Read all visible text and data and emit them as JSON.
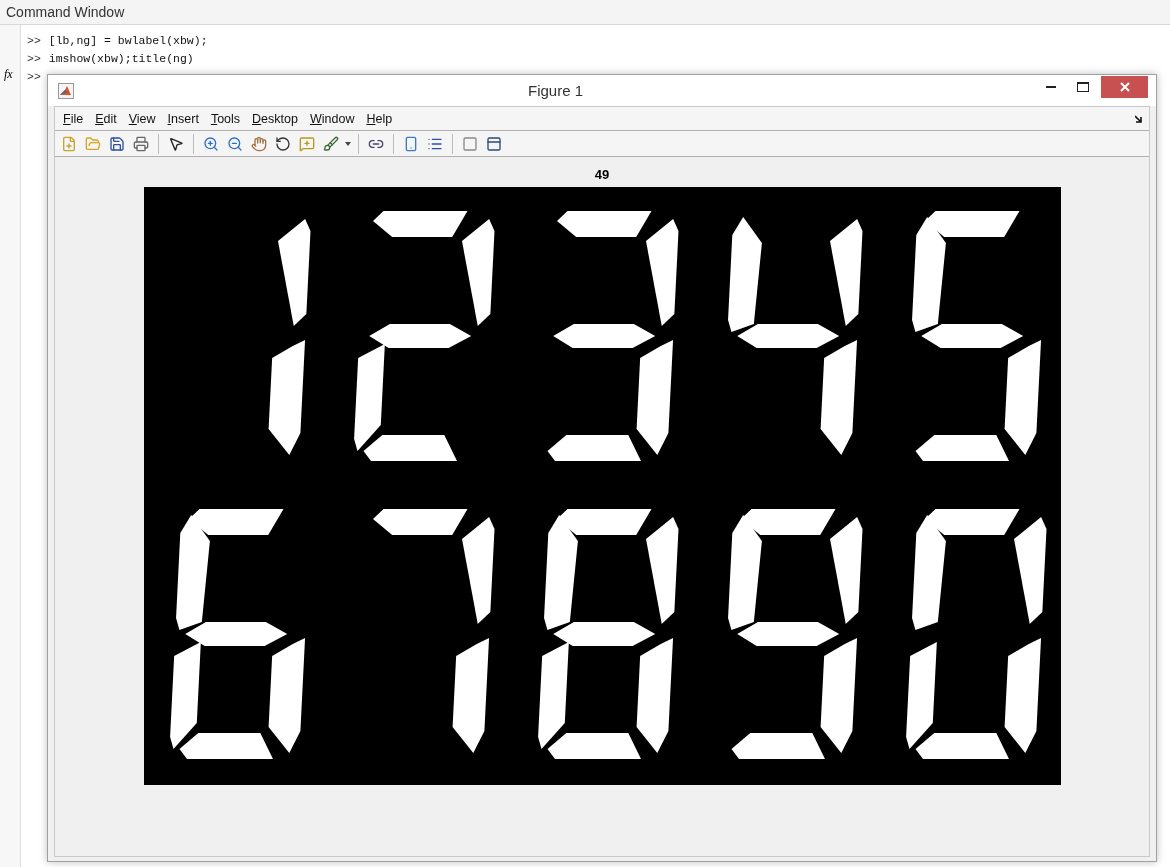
{
  "command_window": {
    "title": "Command Window",
    "lines": [
      {
        "prompt": ">>",
        "code": "[lb,ng] = bwlabel(xbw);"
      },
      {
        "prompt": ">>",
        "code": "imshow(xbw);title(ng)"
      },
      {
        "prompt": ">>"
      }
    ],
    "fx_label": "fx"
  },
  "figure": {
    "title": "Figure 1",
    "menu": [
      "File",
      "Edit",
      "View",
      "Insert",
      "Tools",
      "Desktop",
      "Window",
      "Help"
    ],
    "axes_title": "49"
  }
}
